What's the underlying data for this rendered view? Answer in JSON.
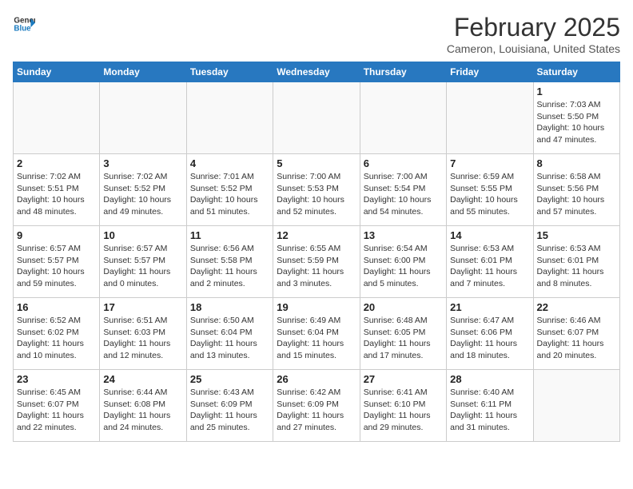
{
  "header": {
    "logo_line1": "General",
    "logo_line2": "Blue",
    "title": "February 2025",
    "subtitle": "Cameron, Louisiana, United States"
  },
  "weekdays": [
    "Sunday",
    "Monday",
    "Tuesday",
    "Wednesday",
    "Thursday",
    "Friday",
    "Saturday"
  ],
  "weeks": [
    [
      {
        "day": "",
        "info": ""
      },
      {
        "day": "",
        "info": ""
      },
      {
        "day": "",
        "info": ""
      },
      {
        "day": "",
        "info": ""
      },
      {
        "day": "",
        "info": ""
      },
      {
        "day": "",
        "info": ""
      },
      {
        "day": "1",
        "info": "Sunrise: 7:03 AM\nSunset: 5:50 PM\nDaylight: 10 hours and 47 minutes."
      }
    ],
    [
      {
        "day": "2",
        "info": "Sunrise: 7:02 AM\nSunset: 5:51 PM\nDaylight: 10 hours and 48 minutes."
      },
      {
        "day": "3",
        "info": "Sunrise: 7:02 AM\nSunset: 5:52 PM\nDaylight: 10 hours and 49 minutes."
      },
      {
        "day": "4",
        "info": "Sunrise: 7:01 AM\nSunset: 5:52 PM\nDaylight: 10 hours and 51 minutes."
      },
      {
        "day": "5",
        "info": "Sunrise: 7:00 AM\nSunset: 5:53 PM\nDaylight: 10 hours and 52 minutes."
      },
      {
        "day": "6",
        "info": "Sunrise: 7:00 AM\nSunset: 5:54 PM\nDaylight: 10 hours and 54 minutes."
      },
      {
        "day": "7",
        "info": "Sunrise: 6:59 AM\nSunset: 5:55 PM\nDaylight: 10 hours and 55 minutes."
      },
      {
        "day": "8",
        "info": "Sunrise: 6:58 AM\nSunset: 5:56 PM\nDaylight: 10 hours and 57 minutes."
      }
    ],
    [
      {
        "day": "9",
        "info": "Sunrise: 6:57 AM\nSunset: 5:57 PM\nDaylight: 10 hours and 59 minutes."
      },
      {
        "day": "10",
        "info": "Sunrise: 6:57 AM\nSunset: 5:57 PM\nDaylight: 11 hours and 0 minutes."
      },
      {
        "day": "11",
        "info": "Sunrise: 6:56 AM\nSunset: 5:58 PM\nDaylight: 11 hours and 2 minutes."
      },
      {
        "day": "12",
        "info": "Sunrise: 6:55 AM\nSunset: 5:59 PM\nDaylight: 11 hours and 3 minutes."
      },
      {
        "day": "13",
        "info": "Sunrise: 6:54 AM\nSunset: 6:00 PM\nDaylight: 11 hours and 5 minutes."
      },
      {
        "day": "14",
        "info": "Sunrise: 6:53 AM\nSunset: 6:01 PM\nDaylight: 11 hours and 7 minutes."
      },
      {
        "day": "15",
        "info": "Sunrise: 6:53 AM\nSunset: 6:01 PM\nDaylight: 11 hours and 8 minutes."
      }
    ],
    [
      {
        "day": "16",
        "info": "Sunrise: 6:52 AM\nSunset: 6:02 PM\nDaylight: 11 hours and 10 minutes."
      },
      {
        "day": "17",
        "info": "Sunrise: 6:51 AM\nSunset: 6:03 PM\nDaylight: 11 hours and 12 minutes."
      },
      {
        "day": "18",
        "info": "Sunrise: 6:50 AM\nSunset: 6:04 PM\nDaylight: 11 hours and 13 minutes."
      },
      {
        "day": "19",
        "info": "Sunrise: 6:49 AM\nSunset: 6:04 PM\nDaylight: 11 hours and 15 minutes."
      },
      {
        "day": "20",
        "info": "Sunrise: 6:48 AM\nSunset: 6:05 PM\nDaylight: 11 hours and 17 minutes."
      },
      {
        "day": "21",
        "info": "Sunrise: 6:47 AM\nSunset: 6:06 PM\nDaylight: 11 hours and 18 minutes."
      },
      {
        "day": "22",
        "info": "Sunrise: 6:46 AM\nSunset: 6:07 PM\nDaylight: 11 hours and 20 minutes."
      }
    ],
    [
      {
        "day": "23",
        "info": "Sunrise: 6:45 AM\nSunset: 6:07 PM\nDaylight: 11 hours and 22 minutes."
      },
      {
        "day": "24",
        "info": "Sunrise: 6:44 AM\nSunset: 6:08 PM\nDaylight: 11 hours and 24 minutes."
      },
      {
        "day": "25",
        "info": "Sunrise: 6:43 AM\nSunset: 6:09 PM\nDaylight: 11 hours and 25 minutes."
      },
      {
        "day": "26",
        "info": "Sunrise: 6:42 AM\nSunset: 6:09 PM\nDaylight: 11 hours and 27 minutes."
      },
      {
        "day": "27",
        "info": "Sunrise: 6:41 AM\nSunset: 6:10 PM\nDaylight: 11 hours and 29 minutes."
      },
      {
        "day": "28",
        "info": "Sunrise: 6:40 AM\nSunset: 6:11 PM\nDaylight: 11 hours and 31 minutes."
      },
      {
        "day": "",
        "info": ""
      }
    ]
  ]
}
